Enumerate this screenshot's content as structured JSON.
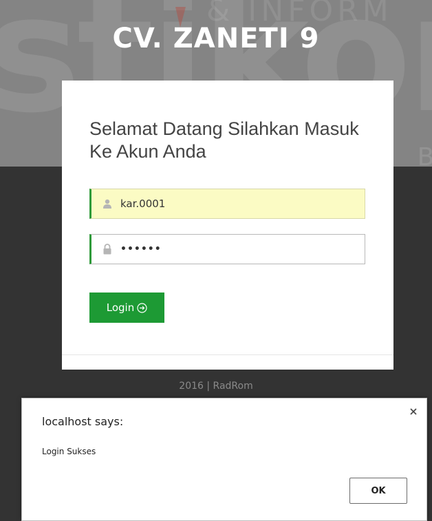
{
  "header": {
    "title": "CV. ZANETI 9"
  },
  "login_card": {
    "welcome_text": "Selamat Datang Silahkan Masuk Ke Akun Anda",
    "username": {
      "icon": "user-icon",
      "value": "kar.0001"
    },
    "password": {
      "icon": "lock-icon",
      "value": "••••••"
    },
    "login_button": {
      "label": "Login",
      "icon": "arrow-circle-right-icon"
    }
  },
  "footer": {
    "copyright": "2016 | RadRom"
  },
  "watermark": {
    "line1": "stikom",
    "line2": "& INFORM",
    "line3": "S U R A B A Y A"
  },
  "dialog": {
    "title": "localhost says:",
    "message": "Login Sukses",
    "ok_label": "OK",
    "close_icon": "close-icon"
  },
  "colors": {
    "accent_green": "#1d9a34",
    "field_border_green": "#2f9a3a",
    "autofill_yellow": "#fbfbc4",
    "top_background": "#848484",
    "bottom_background": "#333333"
  }
}
